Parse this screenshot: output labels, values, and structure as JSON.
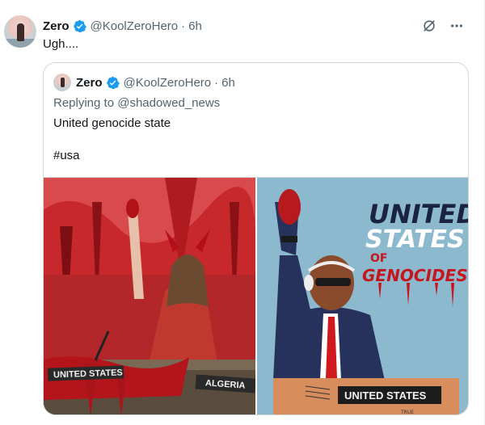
{
  "tweet": {
    "author_name": "Zero",
    "handle": "@KoolZeroHero",
    "time": "6h",
    "text": "Ugh...."
  },
  "icons": {
    "verified": "verified-badge-icon",
    "grok": "grok-icon",
    "more": "more-icon"
  },
  "quote": {
    "author_name": "Zero",
    "handle": "@KoolZeroHero",
    "time": "6h",
    "replying_to": "Replying to @shadowed_news",
    "text": "United genocide state",
    "hashtag": "#usa"
  },
  "images": {
    "left": {
      "placard_1": "UNITED STATES",
      "placard_2": "ALGERIA"
    },
    "right": {
      "title_line_1": "UNITED",
      "title_line_2": "STATES",
      "title_of": "OF",
      "title_line_3": "GENOCIDES",
      "placard": "UNITED STATES",
      "signature": "TRUE"
    }
  },
  "colors": {
    "verified": "#1d9bf0",
    "text": "#0f1419",
    "muted": "#536471",
    "border": "#cfd9de",
    "blood": "#c4161c",
    "cartoon_bg": "#8db9cf"
  }
}
